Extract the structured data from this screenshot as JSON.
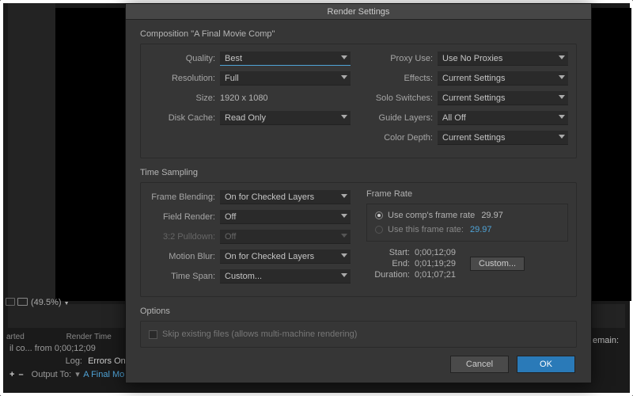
{
  "bg": {
    "zoom": "(49.5%)",
    "headers": {
      "started": "arted",
      "render_time": "Render Time"
    },
    "est_label": "Est. Remain:",
    "queue": {
      "line1": "il co...  from 0;00;12;09",
      "log_label": "Log:",
      "log_value": "Errors Only",
      "plus_minus": "+  –",
      "output_label": "Output To:",
      "output_value": "A Final Mo..."
    }
  },
  "dialog": {
    "title": "Render Settings",
    "comp_label": "Composition \"A Final Movie Comp\"",
    "left": {
      "quality": {
        "label": "Quality:",
        "value": "Best"
      },
      "resolution": {
        "label": "Resolution:",
        "value": "Full"
      },
      "size": {
        "label": "Size:",
        "value": "1920 x 1080"
      },
      "disk_cache": {
        "label": "Disk Cache:",
        "value": "Read Only"
      }
    },
    "right": {
      "proxy": {
        "label": "Proxy Use:",
        "value": "Use No Proxies"
      },
      "effects": {
        "label": "Effects:",
        "value": "Current Settings"
      },
      "solo": {
        "label": "Solo Switches:",
        "value": "Current Settings"
      },
      "guide": {
        "label": "Guide Layers:",
        "value": "All Off"
      },
      "depth": {
        "label": "Color Depth:",
        "value": "Current Settings"
      }
    },
    "time_sampling_label": "Time Sampling",
    "ts_left": {
      "blend": {
        "label": "Frame Blending:",
        "value": "On for Checked Layers"
      },
      "field": {
        "label": "Field Render:",
        "value": "Off"
      },
      "pulldown": {
        "label": "3:2 Pulldown:",
        "value": "Off"
      },
      "mblur": {
        "label": "Motion Blur:",
        "value": "On for Checked Layers"
      },
      "span": {
        "label": "Time Span:",
        "value": "Custom..."
      }
    },
    "frame_rate": {
      "title": "Frame Rate",
      "opt1_label": "Use comp's frame rate",
      "opt1_val": "29.97",
      "opt2_label": "Use this frame rate:",
      "opt2_val": "29.97"
    },
    "times": {
      "start_label": "Start:",
      "start": "0;00;12;09",
      "end_label": "End:",
      "end": "0;01;19;29",
      "dur_label": "Duration:",
      "dur": "0;01;07;21",
      "custom_btn": "Custom..."
    },
    "options_label": "Options",
    "skip_label": "Skip existing files (allows multi-machine rendering)",
    "cancel": "Cancel",
    "ok": "OK"
  }
}
